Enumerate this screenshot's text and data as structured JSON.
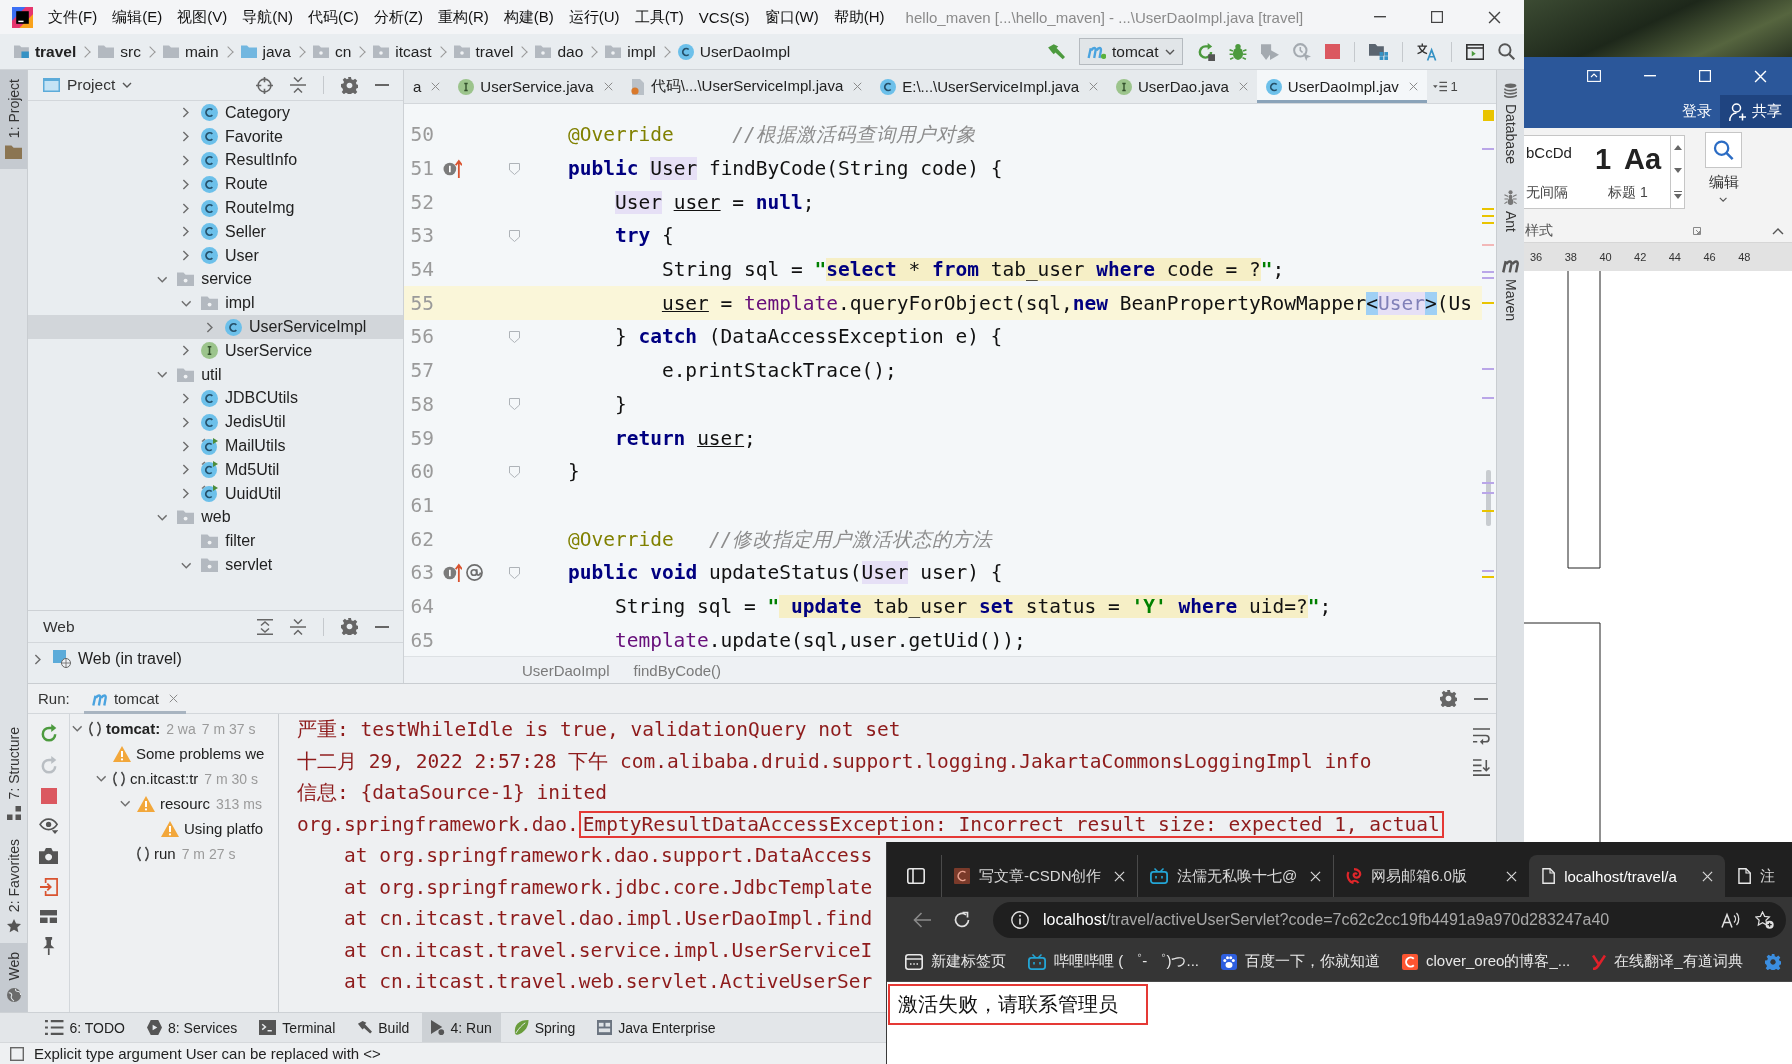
{
  "ide": {
    "menu": [
      "文件(F)",
      "编辑(E)",
      "视图(V)",
      "导航(N)",
      "代码(C)",
      "分析(Z)",
      "重构(R)",
      "构建(B)",
      "运行(U)",
      "工具(T)",
      "VCS(S)",
      "窗口(W)",
      "帮助(H)"
    ],
    "title": "hello_maven [...\\hello_maven] - ...\\UserDaoImpl.java [travel]",
    "breadcrumbs": [
      {
        "label": "travel",
        "kind": "module"
      },
      {
        "label": "src",
        "kind": "folder"
      },
      {
        "label": "main",
        "kind": "folder"
      },
      {
        "label": "java",
        "kind": "source"
      },
      {
        "label": "cn",
        "kind": "package"
      },
      {
        "label": "itcast",
        "kind": "package"
      },
      {
        "label": "travel",
        "kind": "package"
      },
      {
        "label": "dao",
        "kind": "package"
      },
      {
        "label": "impl",
        "kind": "package"
      },
      {
        "label": "UserDaoImpl",
        "kind": "class"
      }
    ],
    "run_config": "tomcat",
    "left_tabs": [
      {
        "label": "1: Project",
        "kind": "project",
        "selected": true
      },
      {
        "label": "7: Structure",
        "kind": "structure",
        "selected": false
      },
      {
        "label": "2: Favorites",
        "kind": "favorites",
        "selected": false
      },
      {
        "label": "Web",
        "kind": "web",
        "selected": true
      }
    ],
    "project_panel": {
      "title": "Project",
      "tree": [
        {
          "children": [
            {
              "label": "Category",
              "kind": "class",
              "expanded": false,
              "selected": false
            },
            {
              "label": "Favorite",
              "kind": "class",
              "expanded": false,
              "selected": false
            },
            {
              "label": "ResultInfo",
              "kind": "class",
              "expanded": false,
              "selected": false
            },
            {
              "label": "Route",
              "kind": "class",
              "expanded": false,
              "selected": false
            },
            {
              "label": "RouteImg",
              "kind": "class",
              "expanded": false,
              "selected": false
            },
            {
              "label": "Seller",
              "kind": "class",
              "expanded": false,
              "selected": false
            },
            {
              "label": "User",
              "kind": "class",
              "expanded": false,
              "selected": false
            }
          ]
        },
        {
          "label": "service",
          "kind": "package",
          "expanded": true,
          "selected": false,
          "children": [
            {
              "label": "impl",
              "kind": "package",
              "expanded": true,
              "selected": false,
              "children": [
                {
                  "label": "UserServiceImpl",
                  "kind": "class",
                  "expanded": false,
                  "selected": true
                }
              ]
            },
            {
              "label": "UserService",
              "kind": "interface",
              "expanded": false,
              "selected": false
            }
          ]
        },
        {
          "label": "util",
          "kind": "package",
          "expanded": true,
          "selected": false,
          "children": [
            {
              "label": "JDBCUtils",
              "kind": "class",
              "expanded": false,
              "selected": false
            },
            {
              "label": "JedisUtil",
              "kind": "class",
              "expanded": false,
              "selected": false
            },
            {
              "label": "MailUtils",
              "kind": "main",
              "expanded": false,
              "selected": false
            },
            {
              "label": "Md5Util",
              "kind": "main",
              "expanded": false,
              "selected": false
            },
            {
              "label": "UuidUtil",
              "kind": "main",
              "expanded": false,
              "selected": false
            }
          ]
        },
        {
          "label": "web",
          "kind": "package",
          "expanded": true,
          "selected": false,
          "children": [
            {
              "label": "filter",
              "kind": "package",
              "selected": false
            },
            {
              "label": "servlet",
              "kind": "package",
              "expanded": true,
              "selected": false
            }
          ]
        }
      ]
    },
    "web_panel": {
      "title": "Web",
      "items": [
        {
          "label": "Web (in travel)",
          "expanded": false
        }
      ]
    },
    "editor": {
      "tabs": [
        {
          "label": "a",
          "kind": "cut",
          "selected": false
        },
        {
          "label": "UserService.java",
          "kind": "interface",
          "selected": false
        },
        {
          "label": "代码\\...\\UserServiceImpl.java",
          "kind": "file",
          "selected": false
        },
        {
          "label": "E:\\...\\UserServiceImpl.java",
          "kind": "class",
          "selected": false
        },
        {
          "label": "UserDao.java",
          "kind": "interface",
          "selected": false
        },
        {
          "label": "UserDaoImpl.jav",
          "kind": "class",
          "selected": true
        }
      ],
      "tab_count": "1",
      "lines": [
        {
          "number": "50",
          "current": false,
          "fold": false,
          "tokens": [
            {
              "text": "    @Override",
              "kind": "annotation"
            },
            {
              "text": "     //根据激活码查询用户对象",
              "kind": "comment"
            }
          ]
        },
        {
          "number": "51",
          "current": false,
          "fold": true,
          "marks": [
            {
              "kind": "implements"
            }
          ],
          "tokens": [
            {
              "text": "    public",
              "kind": "keyword"
            },
            {
              "text": " User",
              "kind": "type"
            },
            {
              "text": " findByCode(String code) {",
              "kind": "plain"
            }
          ]
        },
        {
          "number": "52",
          "current": false,
          "fold": false,
          "tokens": [
            {
              "text": "        User",
              "kind": "type"
            },
            {
              "text": " user",
              "kind": "local"
            },
            {
              "text": " = ",
              "kind": "plain"
            },
            {
              "text": "null",
              "kind": "keyword"
            },
            {
              "text": ";",
              "kind": "plain"
            }
          ]
        },
        {
          "number": "53",
          "current": false,
          "fold": true,
          "tokens": [
            {
              "text": "        try",
              "kind": "keyword"
            },
            {
              "text": " {",
              "kind": "plain"
            }
          ]
        },
        {
          "number": "54",
          "current": false,
          "fold": false,
          "tokens": [
            {
              "text": "            String sql = ",
              "kind": "plain"
            },
            {
              "text": "\"",
              "kind": "quote"
            },
            {
              "text": "select",
              "kind": "sqlkeyword"
            },
            {
              "text": " * ",
              "kind": "sql"
            },
            {
              "text": "from",
              "kind": "sqlkeyword"
            },
            {
              "text": " tab_user ",
              "kind": "sql"
            },
            {
              "text": "where",
              "kind": "sqlkeyword"
            },
            {
              "text": " code = ?",
              "kind": "sql"
            },
            {
              "text": "\"",
              "kind": "quote"
            },
            {
              "text": ";",
              "kind": "plain"
            }
          ]
        },
        {
          "number": "55",
          "current": true,
          "fold": false,
          "tokens": [
            {
              "text": "            user",
              "kind": "local"
            },
            {
              "text": " = ",
              "kind": "plain"
            },
            {
              "text": "template",
              "kind": "field"
            },
            {
              "text": ".queryForObject(sql,",
              "kind": "plain"
            },
            {
              "text": "new",
              "kind": "keyword"
            },
            {
              "text": " BeanPropertyRowMapper",
              "kind": "plain"
            },
            {
              "text": "<",
              "kind": "brace"
            },
            {
              "text": "User",
              "kind": "redundant"
            },
            {
              "text": ">",
              "kind": "brace"
            },
            {
              "text": "(Us",
              "kind": "plain"
            }
          ]
        },
        {
          "number": "56",
          "current": false,
          "fold": true,
          "tokens": [
            {
              "text": "        } ",
              "kind": "plain"
            },
            {
              "text": "catch",
              "kind": "keyword"
            },
            {
              "text": " (DataAccessException e) {",
              "kind": "plain"
            }
          ]
        },
        {
          "number": "57",
          "current": false,
          "fold": false,
          "tokens": [
            {
              "text": "            e.printStackTrace();",
              "kind": "plain"
            }
          ]
        },
        {
          "number": "58",
          "current": false,
          "fold": true,
          "tokens": [
            {
              "text": "        }",
              "kind": "plain"
            }
          ]
        },
        {
          "number": "59",
          "current": false,
          "fold": false,
          "tokens": [
            {
              "text": "        return",
              "kind": "keyword"
            },
            {
              "text": " user",
              "kind": "local"
            },
            {
              "text": ";",
              "kind": "plain"
            }
          ]
        },
        {
          "number": "60",
          "current": false,
          "fold": true,
          "tokens": [
            {
              "text": "    }",
              "kind": "plain"
            }
          ]
        },
        {
          "number": "61",
          "current": false,
          "fold": false
        },
        {
          "number": "62",
          "current": false,
          "fold": false,
          "tokens": [
            {
              "text": "    @Override",
              "kind": "annotation"
            },
            {
              "text": "   //修改指定用户激活状态的方法",
              "kind": "comment"
            }
          ]
        },
        {
          "number": "63",
          "current": false,
          "fold": true,
          "marks": [
            {
              "kind": "implements"
            },
            {
              "kind": "annotation"
            }
          ],
          "tokens": [
            {
              "text": "    public",
              "kind": "keyword"
            },
            {
              "text": " void",
              "kind": "keyword"
            },
            {
              "text": " updateStatus(",
              "kind": "plain"
            },
            {
              "text": "User",
              "kind": "type"
            },
            {
              "text": " user) {",
              "kind": "plain"
            }
          ]
        },
        {
          "number": "64",
          "current": false,
          "fold": false,
          "tokens": [
            {
              "text": "        String sql = ",
              "kind": "plain"
            },
            {
              "text": "\"",
              "kind": "quote"
            },
            {
              "text": " update",
              "kind": "sqlkeyword"
            },
            {
              "text": " tab_user ",
              "kind": "sql"
            },
            {
              "text": "set",
              "kind": "sqlkeyword"
            },
            {
              "text": " status = ",
              "kind": "sql"
            },
            {
              "text": "'Y'",
              "kind": "sqlstring"
            },
            {
              "text": " where",
              "kind": "sqlkeyword"
            },
            {
              "text": " uid=?",
              "kind": "sql"
            },
            {
              "text": "\"",
              "kind": "quote"
            },
            {
              "text": ";",
              "kind": "plain"
            }
          ]
        },
        {
          "number": "65",
          "current": false,
          "fold": false,
          "tokens": [
            {
              "text": "        template",
              "kind": "field"
            },
            {
              "text": ".update(sql,user.getUid());",
              "kind": "plain"
            }
          ]
        }
      ],
      "path": [
        "UserDaoImpl",
        "findByCode()"
      ]
    },
    "right_tabs": [
      {
        "label": "Database",
        "kind": "database"
      },
      {
        "label": "Ant",
        "kind": "ant"
      },
      {
        "label": "Maven",
        "kind": "maven"
      }
    ],
    "run_panel": {
      "label": "Run:",
      "tab": "tomcat",
      "tree": [
        {
          "label": "tomcat:",
          "note": "2 wa",
          "time": "7 m 37 s",
          "kind": "running",
          "expanded": true,
          "children": [
            {
              "label": "Some problems we",
              "kind": "warning"
            },
            {
              "label": "cn.itcast:tr",
              "time": "7 m 30 s",
              "kind": "running",
              "expanded": true,
              "children": [
                {
                  "label": "resourc",
                  "time": "313 ms",
                  "kind": "warning",
                  "expanded": true,
                  "children": [
                    {
                      "label": "Using platfo",
                      "kind": "warning"
                    }
                  ]
                },
                {
                  "label": "run",
                  "time": "7 m 27 s",
                  "kind": "running"
                }
              ]
            }
          ]
        }
      ],
      "console": [
        {
          "text": "严重: testWhileIdle is true, validationQuery not set",
          "kind": "log"
        },
        {
          "text": "十二月 29, 2022 2:57:28 下午 com.alibaba.druid.support.logging.JakartaCommonsLoggingImpl info",
          "kind": "log"
        },
        {
          "text": "信息: {dataSource-1} inited",
          "kind": "log"
        },
        {
          "text": "org.springframework.dao.",
          "boxed": "EmptyResultDataAccessException: Incorrect result size: expected 1, actual",
          "kind": "log"
        },
        {
          "text": "at org.springframework.dao.support.DataAccess",
          "kind": "trace"
        },
        {
          "text": "at org.springframework.jdbc.core.JdbcTemplate",
          "kind": "trace"
        },
        {
          "text": "at cn.itcast.travel.dao.impl.UserDaoImpl.find",
          "kind": "trace"
        },
        {
          "text": "at cn.itcast.travel.service.impl.UserServiceI",
          "kind": "trace"
        },
        {
          "text": "at cn.itcast.travel.web.servlet.ActiveUserSer",
          "kind": "trace"
        }
      ]
    },
    "tool_windows": [
      {
        "label": "6: TODO",
        "kind": "todo",
        "selected": false
      },
      {
        "label": "8: Services",
        "kind": "services",
        "selected": false
      },
      {
        "label": "Terminal",
        "kind": "terminal",
        "selected": false
      },
      {
        "label": "Build",
        "kind": "build",
        "selected": false
      },
      {
        "label": "4: Run",
        "kind": "run",
        "selected": true
      },
      {
        "label": "Spring",
        "kind": "spring",
        "selected": false
      },
      {
        "label": "Java Enterprise",
        "kind": "enterprise",
        "selected": false
      }
    ],
    "status": "Explicit type argument User can be replaced with <>"
  },
  "word": {
    "sign_in": "登录",
    "share": "共享",
    "styles": [
      {
        "preview": "bCcDd",
        "name": "无间隔",
        "kind": "plain"
      },
      {
        "preview": "1 Aa",
        "name": "标题 1",
        "kind": "heading"
      }
    ],
    "styles_group": "样式",
    "editing": "编辑",
    "ruler": [
      "36",
      "38",
      "40",
      "42",
      "44",
      "46",
      "48"
    ]
  },
  "browser": {
    "tabs": [
      {
        "label": "写文章-CSDN创作",
        "kind": "csdn",
        "selected": false
      },
      {
        "label": "法儒无私唤十七@",
        "kind": "tv",
        "selected": false
      },
      {
        "label": "网易邮箱6.0版",
        "kind": "mail",
        "selected": false
      },
      {
        "label": "localhost/travel/a",
        "kind": "page",
        "selected": true
      },
      {
        "label": "注",
        "kind": "page",
        "selected": false
      }
    ],
    "url": {
      "host": "localhost",
      "rest": "/travel/activeUserServlet?code=7c62c2cc19fb4491a9a970d283247a40"
    },
    "bookmarks": [
      {
        "label": "新建标签页",
        "kind": "newtab"
      },
      {
        "label": "哔哩哔哩 ( ゜- ゜)つ...",
        "kind": "tv"
      },
      {
        "label": "百度一下，你就知道",
        "kind": "paw"
      },
      {
        "label": "clover_oreo的博客_...",
        "kind": "clogo"
      },
      {
        "label": "在线翻译_有道词典",
        "kind": "ylogo"
      }
    ],
    "message": "激活失败，请联系管理员"
  }
}
